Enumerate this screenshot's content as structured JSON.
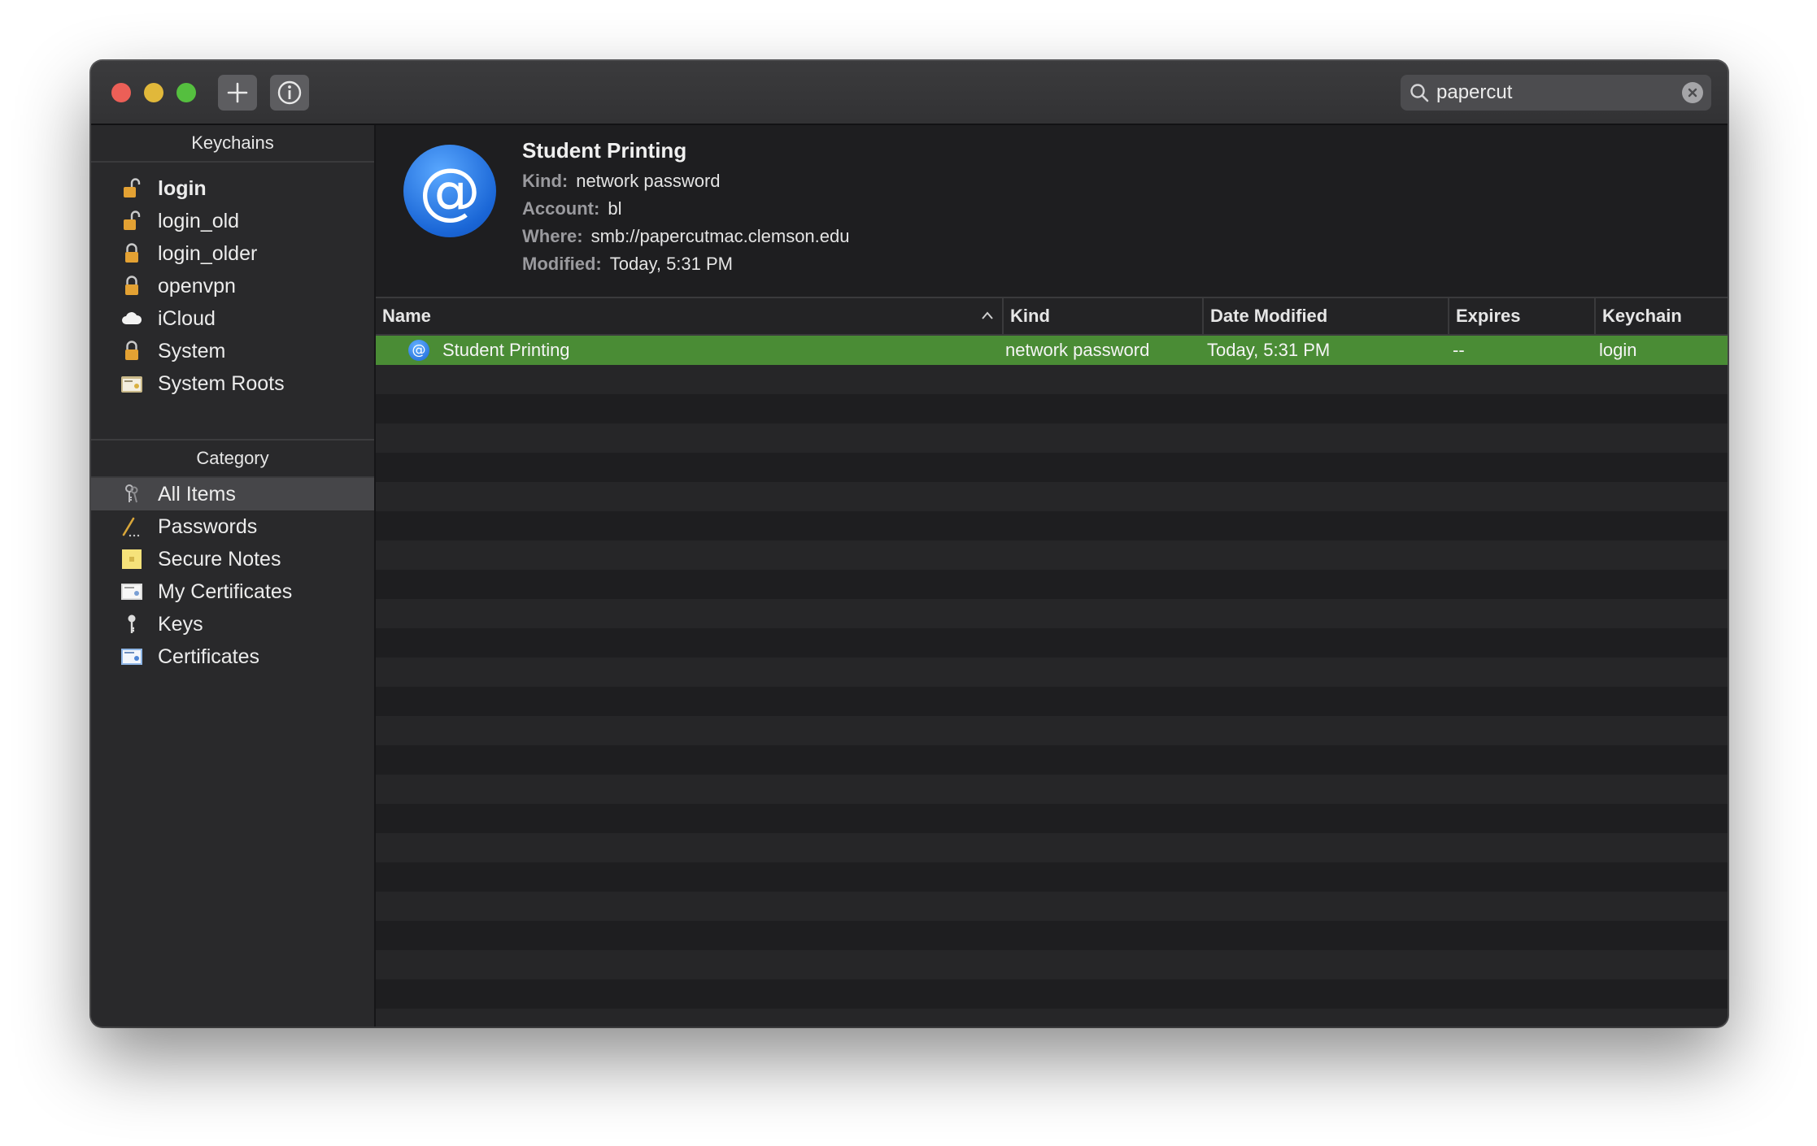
{
  "toolbar": {
    "add_icon": "plus-icon",
    "info_icon": "info-icon"
  },
  "search": {
    "value": "papercut",
    "icon": "search-icon"
  },
  "sidebar": {
    "keychains_header": "Keychains",
    "keychains": [
      {
        "label": "login",
        "icon": "unlocked-padlock-icon",
        "bold": true
      },
      {
        "label": "login_old",
        "icon": "unlocked-padlock-icon"
      },
      {
        "label": "login_older",
        "icon": "padlock-icon"
      },
      {
        "label": "openvpn",
        "icon": "padlock-icon"
      },
      {
        "label": "iCloud",
        "icon": "cloud-icon"
      },
      {
        "label": "System",
        "icon": "padlock-icon"
      },
      {
        "label": "System Roots",
        "icon": "certificate-folder-icon"
      }
    ],
    "category_header": "Category",
    "categories": [
      {
        "label": "All Items",
        "icon": "keys-icon",
        "selected": true
      },
      {
        "label": "Passwords",
        "icon": "pen-icon"
      },
      {
        "label": "Secure Notes",
        "icon": "note-icon"
      },
      {
        "label": "My Certificates",
        "icon": "my-certificate-icon"
      },
      {
        "label": "Keys",
        "icon": "key-icon"
      },
      {
        "label": "Certificates",
        "icon": "certificate-icon"
      }
    ]
  },
  "detail": {
    "title": "Student Printing",
    "kind_label": "Kind:",
    "kind_value": "network password",
    "account_label": "Account:",
    "account_value": "bl",
    "where_label": "Where:",
    "where_value": "smb://papercutmac.clemson.edu",
    "modified_label": "Modified:",
    "modified_value": "Today, 5:31 PM",
    "icon": "at-sign-icon"
  },
  "table": {
    "columns": [
      "Name",
      "Kind",
      "Date Modified",
      "Expires",
      "Keychain"
    ],
    "sort_column": "Name",
    "rows": [
      {
        "name": "Student Printing",
        "kind": "network password",
        "modified": "Today, 5:31 PM",
        "expires": "--",
        "keychain": "login",
        "selected": true
      }
    ]
  },
  "colors": {
    "selection_green": "#4a8c35",
    "close": "#ec5f57",
    "minimize": "#e1b83a",
    "maximize": "#55bf3f"
  }
}
